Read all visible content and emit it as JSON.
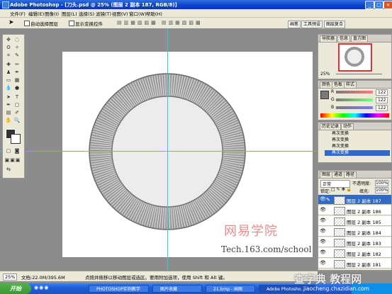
{
  "window": {
    "title": "Adobe Photoshop - [刀头.psd @ 25% (图层 2 副本 187, RGB/8)]"
  },
  "menu": [
    "文件(F)",
    "编辑(E)",
    "图像(I)",
    "图层(L)",
    "选择(S)",
    "滤镜(T)",
    "视图(V)",
    "窗口(W)",
    "帮助(H)"
  ],
  "options": {
    "auto_select_layer": "自动选择图层",
    "show_transform": "显示变换控件"
  },
  "workspace_tabs": [
    "画笔",
    "工具预设",
    "图层复合"
  ],
  "navigator": {
    "tabs": [
      "导航器",
      "信息",
      "直方图"
    ],
    "zoom": "25%"
  },
  "color_panel": {
    "tabs": [
      "颜色",
      "色板",
      "样式"
    ],
    "channels": [
      {
        "label": "R",
        "value": "122"
      },
      {
        "label": "G",
        "value": "122"
      },
      {
        "label": "B",
        "value": "122"
      }
    ]
  },
  "history_panel": {
    "tabs": [
      "历史记录",
      "动作"
    ],
    "items": [
      "再次变换",
      "再次变换",
      "再次变换",
      "再次变换"
    ]
  },
  "layers_panel": {
    "tabs": [
      "图层",
      "通道",
      "路径"
    ],
    "blend_mode": "正常",
    "opacity_label": "不透明度:",
    "opacity": "100%",
    "lock_label": "锁定:",
    "fill_label": "填充:",
    "fill": "100%",
    "layers": [
      "图层 2 副本 187",
      "图层 2 副本 186",
      "图层 2 副本 185",
      "图层 2 副本 184",
      "图层 2 副本 183",
      "图层 2 副本 182",
      "图层 2 副本 181"
    ]
  },
  "status": {
    "zoom": "25%",
    "doc_info": "文档:22.0M/395.6M",
    "hint": "点按并拖移以移动图层或选区。要用附加选项，使用 Shift 和 Alt 键。"
  },
  "taskbar": {
    "start": "开始",
    "tasks": [
      "PHOTOSHOP实例教学",
      "图片收藏",
      "21.bmp - 画图",
      "Adobe Photosho..."
    ]
  },
  "watermarks": {
    "netease": "网易学院",
    "site": "Tech.163.com/school",
    "chazidian": "查字典 教程网",
    "chazidian_url": "jiaocheng.chazidian.com"
  },
  "colors": {
    "title_bar": "#0b43c8",
    "guide": "#33c8e8",
    "ring": "#9a9a9a",
    "selection": "#316ac5"
  }
}
